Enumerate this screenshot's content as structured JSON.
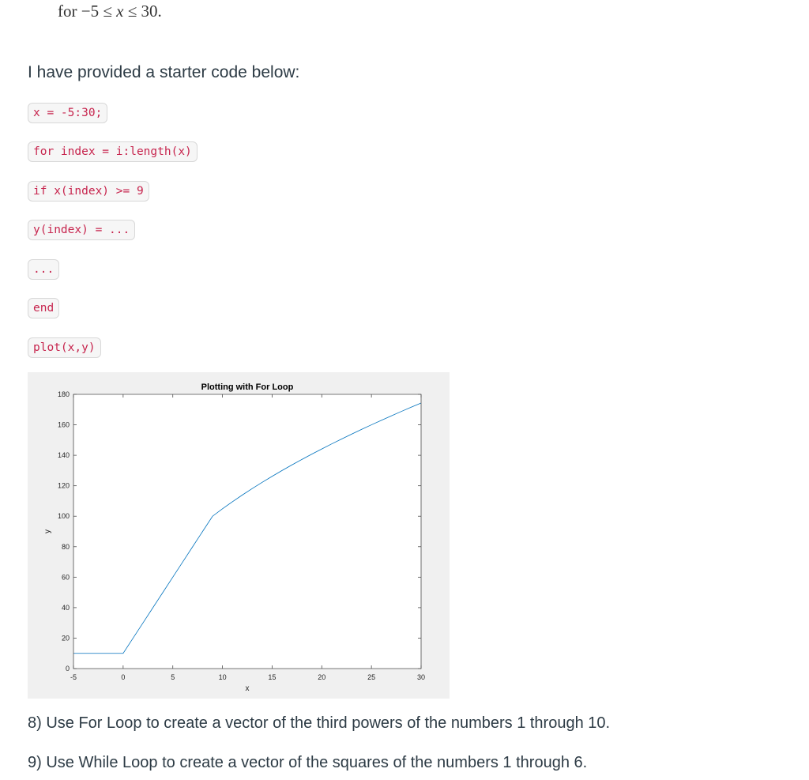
{
  "problem_range": {
    "prefix": "for ",
    "lower": "−5",
    "op1": " ≤ ",
    "var": "x",
    "op2": " ≤ ",
    "upper": "30."
  },
  "intro_text": "I have provided a starter code below:",
  "code_lines": [
    "x = -5:30;",
    "for index = i:length(x)",
    "if x(index) >= 9",
    "y(index) = ...",
    "...",
    "end",
    "plot(x,y)"
  ],
  "chart_data": {
    "type": "line",
    "title": "Plotting with For Loop",
    "xlabel": "x",
    "ylabel": "y",
    "xlim": [
      -5,
      30
    ],
    "ylim": [
      0,
      180
    ],
    "xticks": [
      -5,
      0,
      5,
      10,
      15,
      20,
      25,
      30
    ],
    "yticks": [
      0,
      20,
      40,
      60,
      80,
      100,
      120,
      140,
      160,
      180
    ],
    "grid": false,
    "line_color": "#0072bd",
    "series": [
      {
        "name": "y",
        "x": [
          -5,
          -4,
          -3,
          -2,
          -1,
          0,
          1,
          2,
          3,
          4,
          5,
          6,
          7,
          8,
          9,
          10,
          11,
          12,
          13,
          14,
          15,
          16,
          17,
          18,
          19,
          20,
          21,
          22,
          23,
          24,
          25,
          26,
          27,
          28,
          29,
          30
        ],
        "y": [
          10,
          10,
          10,
          10,
          10,
          10,
          20,
          30,
          40,
          50,
          60,
          70,
          80,
          90,
          100,
          104.87,
          109.5,
          113.92,
          118.17,
          122.25,
          126.19,
          130,
          133.69,
          137.28,
          140.77,
          144.16,
          147.48,
          150.71,
          153.88,
          156.97,
          160,
          162.97,
          165.88,
          168.75,
          171.55,
          174.32
        ]
      }
    ]
  },
  "questions": [
    "8) Use For Loop to create a vector of the third powers of the numbers 1 through 10.",
    "9) Use While Loop to create a vector of the squares of the numbers 1 through 6."
  ]
}
